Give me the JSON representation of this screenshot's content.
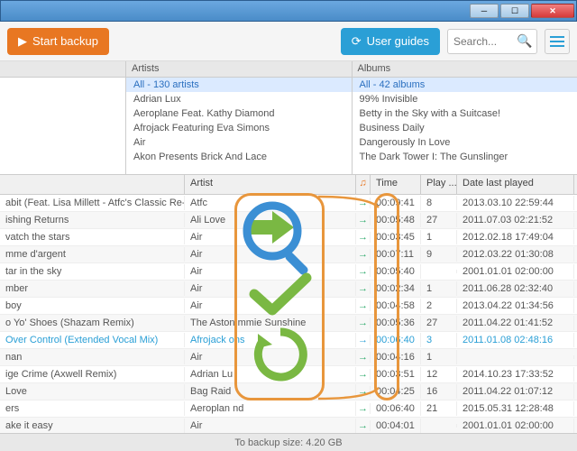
{
  "toolbar": {
    "start_backup": "Start backup",
    "user_guides": "User guides",
    "search_placeholder": "Search..."
  },
  "browser": {
    "col_left": {
      "items": [
        "",
        "",
        "",
        "",
        "",
        ""
      ]
    },
    "col_artists": {
      "header": "Artists",
      "items": [
        {
          "label": "All - 130 artists",
          "sel": true
        },
        {
          "label": "Adrian Lux"
        },
        {
          "label": "Aeroplane Feat. Kathy Diamond"
        },
        {
          "label": "Afrojack Featuring Eva Simons"
        },
        {
          "label": "Air"
        },
        {
          "label": "Akon Presents Brick And Lace"
        }
      ]
    },
    "col_albums": {
      "header": "Albums",
      "items": [
        {
          "label": "All - 42 albums",
          "sel": true
        },
        {
          "label": "99% Invisible"
        },
        {
          "label": "Betty in the Sky with a Suitcase!"
        },
        {
          "label": "Business Daily"
        },
        {
          "label": "Dangerously In Love"
        },
        {
          "label": "The Dark Tower I: The Gunslinger"
        }
      ]
    }
  },
  "table": {
    "headers": {
      "name": "",
      "artist": "Artist",
      "time": "Time",
      "play": "Play ...",
      "date": "Date last played"
    },
    "rows": [
      {
        "name": "abit (Feat. Lisa Millett - Atfc's Classic Re-Mixed)",
        "artist": "Atfc",
        "time": "00:09:41",
        "play": "8",
        "date": "2013.03.10 22:59:44"
      },
      {
        "name": "ishing Returns",
        "artist": "Ali Love",
        "time": "00:05:48",
        "play": "27",
        "date": "2011.07.03 02:21:52"
      },
      {
        "name": "vatch the stars",
        "artist": "Air",
        "time": "00:03:45",
        "play": "1",
        "date": "2012.02.18 17:49:04"
      },
      {
        "name": "mme d'argent",
        "artist": "Air",
        "time": "00:07:11",
        "play": "9",
        "date": "2012.03.22 01:30:08"
      },
      {
        "name": "tar in the sky",
        "artist": "Air",
        "time": "00:05:40",
        "play": "",
        "date": "2001.01.01 02:00:00"
      },
      {
        "name": "mber",
        "artist": "Air",
        "time": "00:02:34",
        "play": "1",
        "date": "2011.06.28 02:32:40"
      },
      {
        "name": "boy",
        "artist": "Air",
        "time": "00:04:58",
        "play": "2",
        "date": "2013.04.22 01:34:56"
      },
      {
        "name": "o Yo' Shoes (Shazam Remix)",
        "artist": "The Aston                  mmie Sunshine",
        "time": "00:05:36",
        "play": "27",
        "date": "2011.04.22 01:41:52"
      },
      {
        "name": "Over Control (Extended Vocal Mix)",
        "artist": "Afrojack                   ons",
        "time": "00:06:40",
        "play": "3",
        "date": "2011.01.08 02:48:16",
        "sel": true
      },
      {
        "name": "nan",
        "artist": "Air",
        "time": "00:04:16",
        "play": "1",
        "date": ""
      },
      {
        "name": "ige Crime (Axwell Remix)",
        "artist": "Adrian Lu",
        "time": "00:03:51",
        "play": "12",
        "date": "2014.10.23 17:33:52"
      },
      {
        "name": " Love",
        "artist": "Bag Raid",
        "time": "00:04:25",
        "play": "16",
        "date": "2011.04.22 01:07:12"
      },
      {
        "name": "ers",
        "artist": "Aeroplan                   nd",
        "time": "00:06:40",
        "play": "21",
        "date": "2015.05.31 12:28:48"
      },
      {
        "name": "ake it easy",
        "artist": "Air",
        "time": "00:04:01",
        "play": "",
        "date": "2001.01.01 02:00:00"
      }
    ]
  },
  "footer": {
    "text": "To backup size: 4.20 GB"
  },
  "icons": {
    "play": "♫",
    "arrow": "→"
  }
}
